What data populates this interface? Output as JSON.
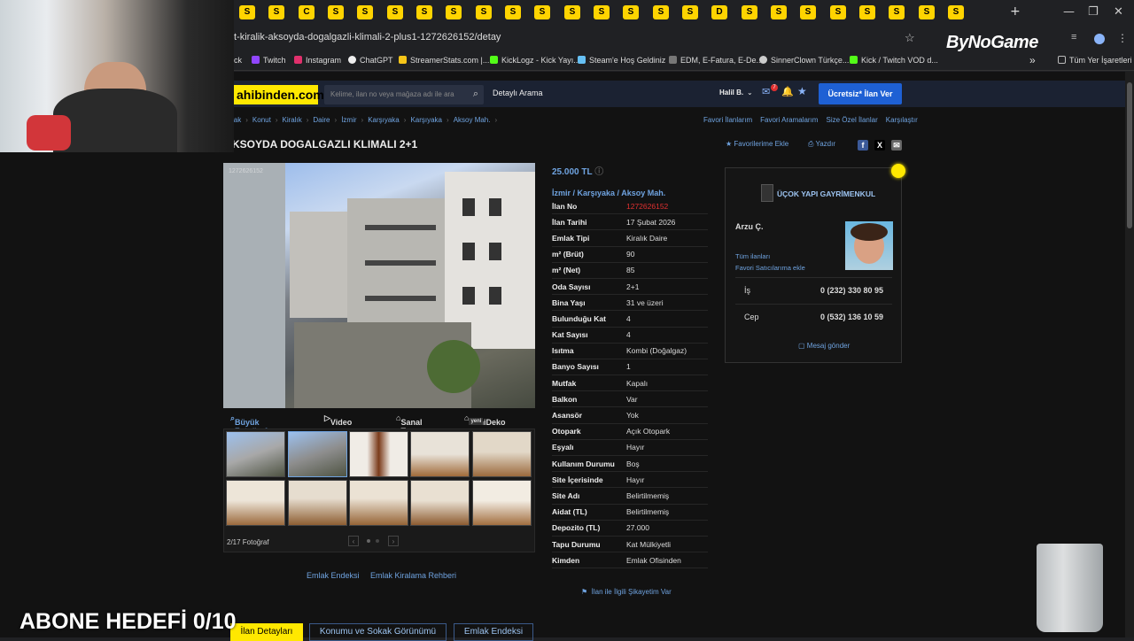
{
  "browser": {
    "url": "t-kiralik-aksoyda-dogalgazli-klimali-2-plus1-1272626152/detay",
    "new_tab": "+",
    "window_controls": [
      "—",
      "❐",
      "✕"
    ],
    "bookmarks": [
      {
        "label": "ck",
        "color": "#00000000"
      },
      {
        "label": "Twitch",
        "color": "#9146ff"
      },
      {
        "label": "Instagram",
        "color": "#e1306c"
      },
      {
        "label": "ChatGPT",
        "color": "#eeeeee"
      },
      {
        "label": "StreamerStats.com |...",
        "color": "#f5c518"
      },
      {
        "label": "KickLogz - Kick Yayı...",
        "color": "#53fc18"
      },
      {
        "label": "Steam'e Hoş Geldiniz",
        "color": "#66c0f4"
      },
      {
        "label": "EDM, E-Fatura, E-De...",
        "color": "#00000000"
      },
      {
        "label": "SinnerClown Türkçe...",
        "color": "#cccccc"
      },
      {
        "label": "Kick / Twitch VOD d...",
        "color": "#53fc18"
      }
    ],
    "bookmarks_more": "»",
    "all_bookmarks": "Tüm Yer İşaretleri"
  },
  "overlay": {
    "bynogame": "ByNoGame",
    "abone": "ABONE HEDEFİ 0/10"
  },
  "header": {
    "logo": "ahibinden.com",
    "search_placeholder": "Kelime, ilan no veya mağaza adı ile ara",
    "detailed_search": "Detaylı Arama",
    "user": "Halil B.",
    "notif_count": "7",
    "post_ad": "Ücretsiz* İlan Ver"
  },
  "breadcrumb": [
    "lak",
    "Konut",
    "Kiralık",
    "Daire",
    "İzmir",
    "Karşıyaka",
    "Karşıyaka",
    "Aksoy Mah."
  ],
  "top_links": [
    "Favori İlanlarım",
    "Favori Aramalarım",
    "Size Özel İlanlar",
    "Karşılaştır"
  ],
  "title": "KSOYDA DOGALGAZLI KLIMALI 2+1",
  "actions": {
    "favorite": "Favorilerime Ekle",
    "print": "Yazdır"
  },
  "social": [
    "f",
    "X",
    "✉"
  ],
  "gallery": {
    "tabs": [
      "Büyük Fotoğraf",
      "Video",
      "Sanal Tur",
      "SahiDeko"
    ],
    "tab_badge": "yeni",
    "counter": "2/17 Fotoğraf",
    "photo_id": "1272626152"
  },
  "bottom_links": [
    "Emlak Endeksi",
    "Emlak Kiralama Rehberi"
  ],
  "price": "25.000 TL",
  "location": "İzmir  /  Karşıyaka  /  Aksoy Mah.",
  "details": [
    {
      "k": "İlan No",
      "v": "1272626152",
      "red": true
    },
    {
      "k": "İlan Tarihi",
      "v": "17 Şubat 2026"
    },
    {
      "k": "Emlak Tipi",
      "v": "Kiralık Daire"
    },
    {
      "k": "m² (Brüt)",
      "v": "90"
    },
    {
      "k": "m² (Net)",
      "v": "85"
    },
    {
      "k": "Oda Sayısı",
      "v": "2+1"
    },
    {
      "k": "Bina Yaşı",
      "v": "31 ve üzeri"
    },
    {
      "k": "Bulunduğu Kat",
      "v": "4"
    },
    {
      "k": "Kat Sayısı",
      "v": "4"
    },
    {
      "k": "Isıtma",
      "v": "Kombi (Doğalgaz)"
    },
    {
      "k": "Banyo Sayısı",
      "v": "1"
    },
    {
      "k": "Mutfak",
      "v": "Kapalı"
    },
    {
      "k": "Balkon",
      "v": "Var"
    },
    {
      "k": "Asansör",
      "v": "Yok"
    },
    {
      "k": "Otopark",
      "v": "Açık Otopark"
    },
    {
      "k": "Eşyalı",
      "v": "Hayır"
    },
    {
      "k": "Kullanım Durumu",
      "v": "Boş"
    },
    {
      "k": "Site İçerisinde",
      "v": "Hayır"
    },
    {
      "k": "Site Adı",
      "v": "Belirtilmemiş"
    },
    {
      "k": "Aidat (TL)",
      "v": "Belirtilmemiş"
    },
    {
      "k": "Depozito (TL)",
      "v": "27.000"
    },
    {
      "k": "Tapu Durumu",
      "v": "Kat Mülkiyetli"
    },
    {
      "k": "Kimden",
      "v": "Emlak Ofisinden"
    }
  ],
  "complaint": "İlan ile İlgili Şikayetim Var",
  "seller": {
    "store": "ÜÇOK YAPI GAYRİMENKUL",
    "agent": "Arzu Ç.",
    "all_ads": "Tüm ilanları",
    "fav_seller": "Favori Satıcılarıma ekle",
    "phones": [
      {
        "label": "İş",
        "value": "0 (232) 330 80 95"
      },
      {
        "label": "Cep",
        "value": "0 (532) 136 10 59"
      }
    ],
    "message": "Mesaj gönder"
  },
  "bottom_tabs": [
    "İlan Detayları",
    "Konumu ve Sokak Görünümü",
    "Emlak Endeksi"
  ]
}
